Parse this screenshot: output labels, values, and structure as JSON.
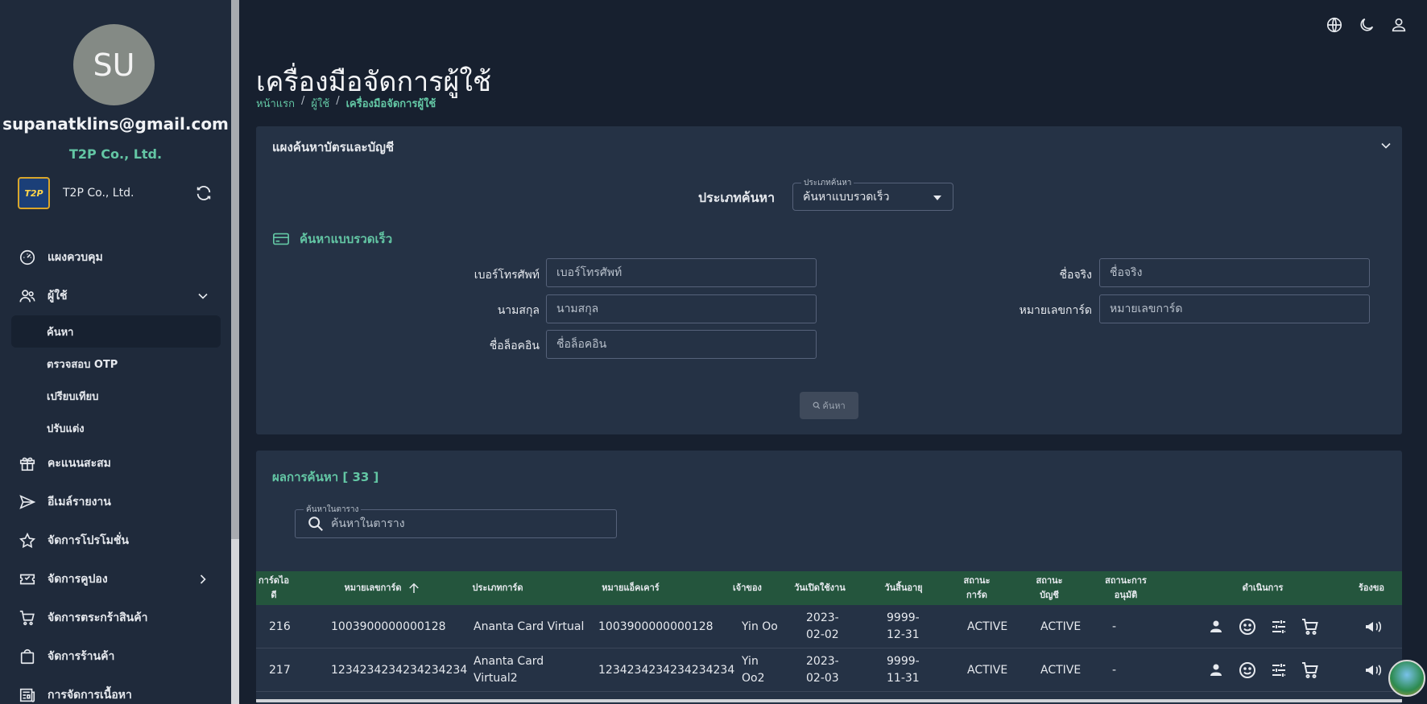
{
  "sidebar": {
    "avatar_initials": "SU",
    "email": "supanatklins@gmail.com",
    "company": "T2P Co., Ltd.",
    "org": {
      "logo_text": "T2P",
      "name": "T2P Co., Ltd."
    },
    "items": [
      {
        "label": "แผงควบคุม",
        "icon": "dashboard-icon"
      },
      {
        "label": "ผู้ใช้",
        "icon": "users-icon"
      },
      {
        "label": "ค้นหา"
      },
      {
        "label": "ตรวจสอบ OTP"
      },
      {
        "label": "เปรียบเทียบ"
      },
      {
        "label": "ปรับแต่ง"
      },
      {
        "label": "คะแนนสะสม",
        "icon": "gift-icon"
      },
      {
        "label": "อีเมล์รายงาน",
        "icon": "send-icon"
      },
      {
        "label": "จัดการโปรโมชั่น",
        "icon": "star-icon"
      },
      {
        "label": "จัดการคูปอง",
        "icon": "coupon-icon"
      },
      {
        "label": "จัดการตระกร้าสินค้า",
        "icon": "cart-icon"
      },
      {
        "label": "จัดการร้านค้า",
        "icon": "shop-bag-icon"
      },
      {
        "label": "การจัดการเนื้อหา",
        "icon": "news-icon"
      }
    ]
  },
  "header": {
    "title": "เครื่องมือจัดการผู้ใช้",
    "breadcrumb": [
      "หน้าแรก",
      "ผู้ใช้",
      "เครื่องมือจัดการผู้ใช้"
    ],
    "separator": "/"
  },
  "search_panel": {
    "title": "แผงค้นหาบัตรและบัญชี",
    "search_type_label": "ประเภทค้นหา",
    "search_type_float": "ประเภทค้นหา",
    "search_type_value": "ค้นหาแบบรวดเร็ว",
    "quick_title": "ค้นหาแบบรวดเร็ว",
    "fields": {
      "phone": {
        "label": "เบอร์โทรศัพท์",
        "placeholder": "เบอร์โทรศัพท์"
      },
      "firstname": {
        "label": "ชื่อจริง",
        "placeholder": "ชื่อจริง"
      },
      "lastname": {
        "label": "นามสกุล",
        "placeholder": "นามสกุล"
      },
      "cardnumber": {
        "label": "หมายเลขการ์ด",
        "placeholder": "หมายเลขการ์ด"
      },
      "login": {
        "label": "ชื่อล็อคอิน",
        "placeholder": "ชื่อล็อคอิน"
      }
    },
    "search_button": "ค้นหา"
  },
  "results": {
    "title": "ผลการค้นหา [ 33 ]",
    "table_search_float": "ค้นหาในตาราง",
    "table_search_placeholder": "ค้นหาในตาราง",
    "columns": {
      "card_id": "การ์ดไอดี",
      "card_number": "หมายเลขการ์ด",
      "card_type": "ประเภทการ์ด",
      "account_number": "หมายแอ็คเคาร์",
      "owner": "เจ้าของ",
      "open_date": "วันเปิดใช้งาน",
      "expiry": "วันสิ้นอายุ",
      "card_status": "สถานะการ์ด",
      "account_status": "สถานะบัญชี",
      "approval_status": "สถานะการอนุมัติ",
      "actions": "ดำเนินการ",
      "request": "ร้องขอ"
    },
    "rows": [
      {
        "card_id": "216",
        "card_number": "1003900000000128",
        "card_type": "Ananta Card Virtual",
        "account_number": "1003900000000128",
        "owner": "Yin Oo",
        "open_date": "2023-02-02",
        "expiry": "9999-12-31",
        "card_status": "ACTIVE",
        "account_status": "ACTIVE",
        "approval_status": "-"
      },
      {
        "card_id": "217",
        "card_number": "1234234234234234234",
        "card_type": "Ananta Card Virtual2",
        "account_number": "1234234234234234234",
        "owner": "Yin Oo2",
        "open_date": "2023-02-03",
        "expiry": "9999-11-31",
        "card_status": "ACTIVE",
        "account_status": "ACTIVE",
        "approval_status": "-"
      }
    ]
  },
  "colors": {
    "accent": "#63c6a4",
    "sidebar_bg": "#1f2a3b",
    "page_bg": "#17202f",
    "panel_bg": "#253245",
    "table_header": "#24553d"
  }
}
